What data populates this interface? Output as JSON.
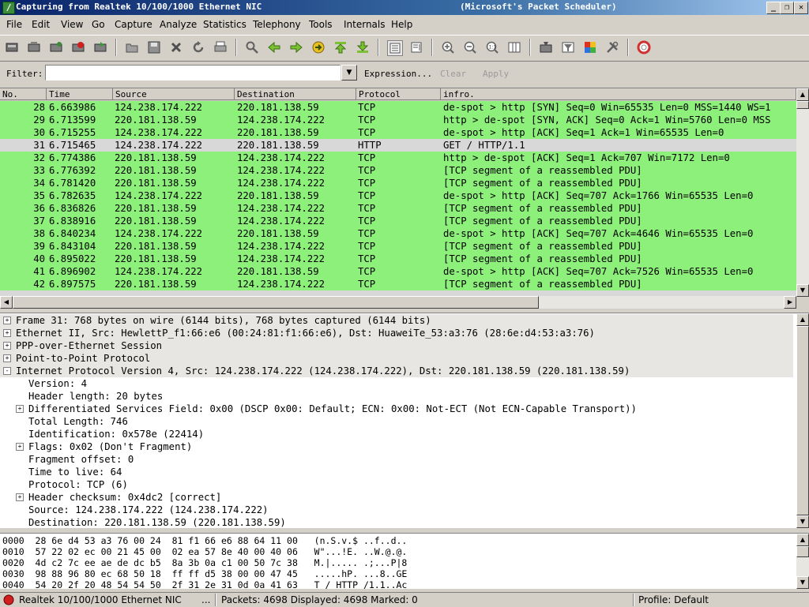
{
  "window": {
    "title": "Capturing from Realtek 10/100/1000 Ethernet NIC",
    "title_right": "(Microsoft's Packet Scheduler)"
  },
  "menu": [
    "File",
    "Edit",
    "View",
    "Go",
    "Capture",
    "Analyze",
    "Statistics",
    "Telephony",
    "Tools",
    "Internals",
    "Help"
  ],
  "filter": {
    "label": "Filter:",
    "value": "",
    "expression": "Expression...",
    "clear": "Clear",
    "apply": "Apply"
  },
  "packet_list": {
    "columns": [
      "No.",
      "Time",
      "Source",
      "Destination",
      "Protocol",
      "infro."
    ],
    "rows": [
      {
        "no": "28",
        "time": "6.663986",
        "src": "124.238.174.222",
        "dst": "220.181.138.59",
        "proto": "TCP",
        "info": "de-spot > http [SYN] Seq=0 Win=65535 Len=0 MSS=1440 WS=1",
        "selected": false
      },
      {
        "no": "29",
        "time": "6.713599",
        "src": "220.181.138.59",
        "dst": "124.238.174.222",
        "proto": "TCP",
        "info": "http > de-spot [SYN, ACK] Seq=0 Ack=1 Win=5760 Len=0 MSS",
        "selected": false
      },
      {
        "no": "30",
        "time": "6.715255",
        "src": "124.238.174.222",
        "dst": "220.181.138.59",
        "proto": "TCP",
        "info": "de-spot > http [ACK] Seq=1 Ack=1 Win=65535 Len=0",
        "selected": false
      },
      {
        "no": "31",
        "time": "6.715465",
        "src": "124.238.174.222",
        "dst": "220.181.138.59",
        "proto": "HTTP",
        "info": "GET / HTTP/1.1",
        "selected": true
      },
      {
        "no": "32",
        "time": "6.774386",
        "src": "220.181.138.59",
        "dst": "124.238.174.222",
        "proto": "TCP",
        "info": "http > de-spot [ACK] Seq=1 Ack=707 Win=7172 Len=0",
        "selected": false
      },
      {
        "no": "33",
        "time": "6.776392",
        "src": "220.181.138.59",
        "dst": "124.238.174.222",
        "proto": "TCP",
        "info": "[TCP segment of a reassembled PDU]",
        "selected": false
      },
      {
        "no": "34",
        "time": "6.781420",
        "src": "220.181.138.59",
        "dst": "124.238.174.222",
        "proto": "TCP",
        "info": "[TCP segment of a reassembled PDU]",
        "selected": false
      },
      {
        "no": "35",
        "time": "6.782635",
        "src": "124.238.174.222",
        "dst": "220.181.138.59",
        "proto": "TCP",
        "info": "de-spot > http [ACK] Seq=707 Ack=1766 Win=65535 Len=0",
        "selected": false
      },
      {
        "no": "36",
        "time": "6.836826",
        "src": "220.181.138.59",
        "dst": "124.238.174.222",
        "proto": "TCP",
        "info": "[TCP segment of a reassembled PDU]",
        "selected": false
      },
      {
        "no": "37",
        "time": "6.838916",
        "src": "220.181.138.59",
        "dst": "124.238.174.222",
        "proto": "TCP",
        "info": "[TCP segment of a reassembled PDU]",
        "selected": false
      },
      {
        "no": "38",
        "time": "6.840234",
        "src": "124.238.174.222",
        "dst": "220.181.138.59",
        "proto": "TCP",
        "info": "de-spot > http [ACK] Seq=707 Ack=4646 Win=65535 Len=0",
        "selected": false
      },
      {
        "no": "39",
        "time": "6.843104",
        "src": "220.181.138.59",
        "dst": "124.238.174.222",
        "proto": "TCP",
        "info": "[TCP segment of a reassembled PDU]",
        "selected": false
      },
      {
        "no": "40",
        "time": "6.895022",
        "src": "220.181.138.59",
        "dst": "124.238.174.222",
        "proto": "TCP",
        "info": "[TCP segment of a reassembled PDU]",
        "selected": false
      },
      {
        "no": "41",
        "time": "6.896902",
        "src": "124.238.174.222",
        "dst": "220.181.138.59",
        "proto": "TCP",
        "info": "de-spot > http [ACK] Seq=707 Ack=7526 Win=65535 Len=0",
        "selected": false
      },
      {
        "no": "42",
        "time": "6.897575",
        "src": "220.181.138.59",
        "dst": "124.238.174.222",
        "proto": "TCP",
        "info": "[TCP segment of a reassembled PDU]",
        "selected": false
      }
    ]
  },
  "details": [
    {
      "indent": 0,
      "expander": "+",
      "text": "Frame 31: 768 bytes on wire (6144 bits), 768 bytes captured (6144 bits)",
      "shaded": true
    },
    {
      "indent": 0,
      "expander": "+",
      "text": "Ethernet II, Src: HewlettP_f1:66:e6 (00:24:81:f1:66:e6), Dst: HuaweiTe_53:a3:76 (28:6e:d4:53:a3:76)",
      "shaded": true
    },
    {
      "indent": 0,
      "expander": "+",
      "text": "PPP-over-Ethernet Session",
      "shaded": true
    },
    {
      "indent": 0,
      "expander": "+",
      "text": "Point-to-Point Protocol",
      "shaded": true
    },
    {
      "indent": 0,
      "expander": "-",
      "text": "Internet Protocol Version 4, Src: 124.238.174.222 (124.238.174.222), Dst: 220.181.138.59 (220.181.138.59)",
      "shaded": true
    },
    {
      "indent": 1,
      "expander": "",
      "text": "Version: 4",
      "shaded": false
    },
    {
      "indent": 1,
      "expander": "",
      "text": "Header length: 20 bytes",
      "shaded": false
    },
    {
      "indent": 1,
      "expander": "+",
      "text": "Differentiated Services Field: 0x00 (DSCP 0x00: Default; ECN: 0x00: Not-ECT (Not ECN-Capable Transport))",
      "shaded": false
    },
    {
      "indent": 1,
      "expander": "",
      "text": "Total Length: 746",
      "shaded": false
    },
    {
      "indent": 1,
      "expander": "",
      "text": "Identification: 0x578e (22414)",
      "shaded": false
    },
    {
      "indent": 1,
      "expander": "+",
      "text": "Flags: 0x02 (Don't Fragment)",
      "shaded": false
    },
    {
      "indent": 1,
      "expander": "",
      "text": "Fragment offset: 0",
      "shaded": false
    },
    {
      "indent": 1,
      "expander": "",
      "text": "Time to live: 64",
      "shaded": false
    },
    {
      "indent": 1,
      "expander": "",
      "text": "Protocol: TCP (6)",
      "shaded": false
    },
    {
      "indent": 1,
      "expander": "+",
      "text": "Header checksum: 0x4dc2 [correct]",
      "shaded": false
    },
    {
      "indent": 1,
      "expander": "",
      "text": "Source: 124.238.174.222 (124.238.174.222)",
      "shaded": false
    },
    {
      "indent": 1,
      "expander": "",
      "text": "Destination: 220.181.138.59 (220.181.138.59)",
      "shaded": false
    }
  ],
  "bytes": [
    "0000  28 6e d4 53 a3 76 00 24  81 f1 66 e6 88 64 11 00   (n.S.v.$ ..f..d..",
    "0010  57 22 02 ec 00 21 45 00  02 ea 57 8e 40 00 40 06   W\"...!E. ..W.@.@.",
    "0020  4d c2 7c ee ae de dc b5  8a 3b 0a c1 00 50 7c 38   M.|..... .;...P|8",
    "0030  98 88 96 80 ec 68 50 18  ff ff d5 38 00 00 47 45   .....hP. ...8..GE",
    "0040  54 20 2f 20 48 54 54 50  2f 31 2e 31 0d 0a 41 63   T / HTTP /1.1..Ac"
  ],
  "status": {
    "interface": "Realtek 10/100/1000 Ethernet NIC",
    "ellipsis": "...",
    "packets": "Packets: 4698 Displayed: 4698 Marked: 0",
    "profile": "Profile: Default"
  },
  "colors": {
    "tcp_row": "#8cf07a",
    "http_row": "#d8d8d8",
    "title_bar": "#0a246a"
  }
}
